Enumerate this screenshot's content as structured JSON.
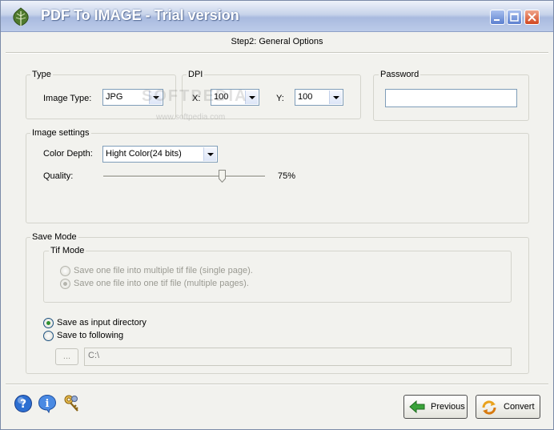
{
  "window": {
    "title": "PDF To IMAGE - Trial version"
  },
  "header": {
    "step": "Step2: General Options"
  },
  "type_group": {
    "label": "Type",
    "image_type_label": "Image Type:",
    "image_type_value": "JPG"
  },
  "dpi_group": {
    "label": "DPI",
    "x_label": "X:",
    "x_value": "100",
    "y_label": "Y:",
    "y_value": "100"
  },
  "password_group": {
    "label": "Password",
    "value": ""
  },
  "image_settings": {
    "label": "Image settings",
    "color_depth_label": "Color Depth:",
    "color_depth_value": "Hight Color(24 bits)",
    "quality_label": "Quality:",
    "quality_value": "75%",
    "quality_level": 0.75
  },
  "save_mode": {
    "label": "Save Mode",
    "tif_mode": {
      "label": "Tif Mode",
      "options": [
        {
          "label": "Save one file into multiple tif file (single page).",
          "selected": false,
          "enabled": false
        },
        {
          "label": "Save one file into one tif file (multiple pages).",
          "selected": true,
          "enabled": false
        }
      ]
    },
    "options": [
      {
        "label": "Save as input directory",
        "selected": true
      },
      {
        "label": "Save to following",
        "selected": false
      }
    ],
    "browse_label": "...",
    "path_value": "C:\\"
  },
  "watermark": {
    "text": "SOFTPEDIA",
    "url": "www.softpedia.com"
  },
  "footer": {
    "previous_label": "Previous",
    "convert_label": "Convert",
    "icons": [
      "help-icon",
      "info-icon",
      "register-key-icon"
    ]
  },
  "colors": {
    "title_text": "#ffffff",
    "radio_selected": "#2f8f2f",
    "border": "#7f9db9"
  }
}
